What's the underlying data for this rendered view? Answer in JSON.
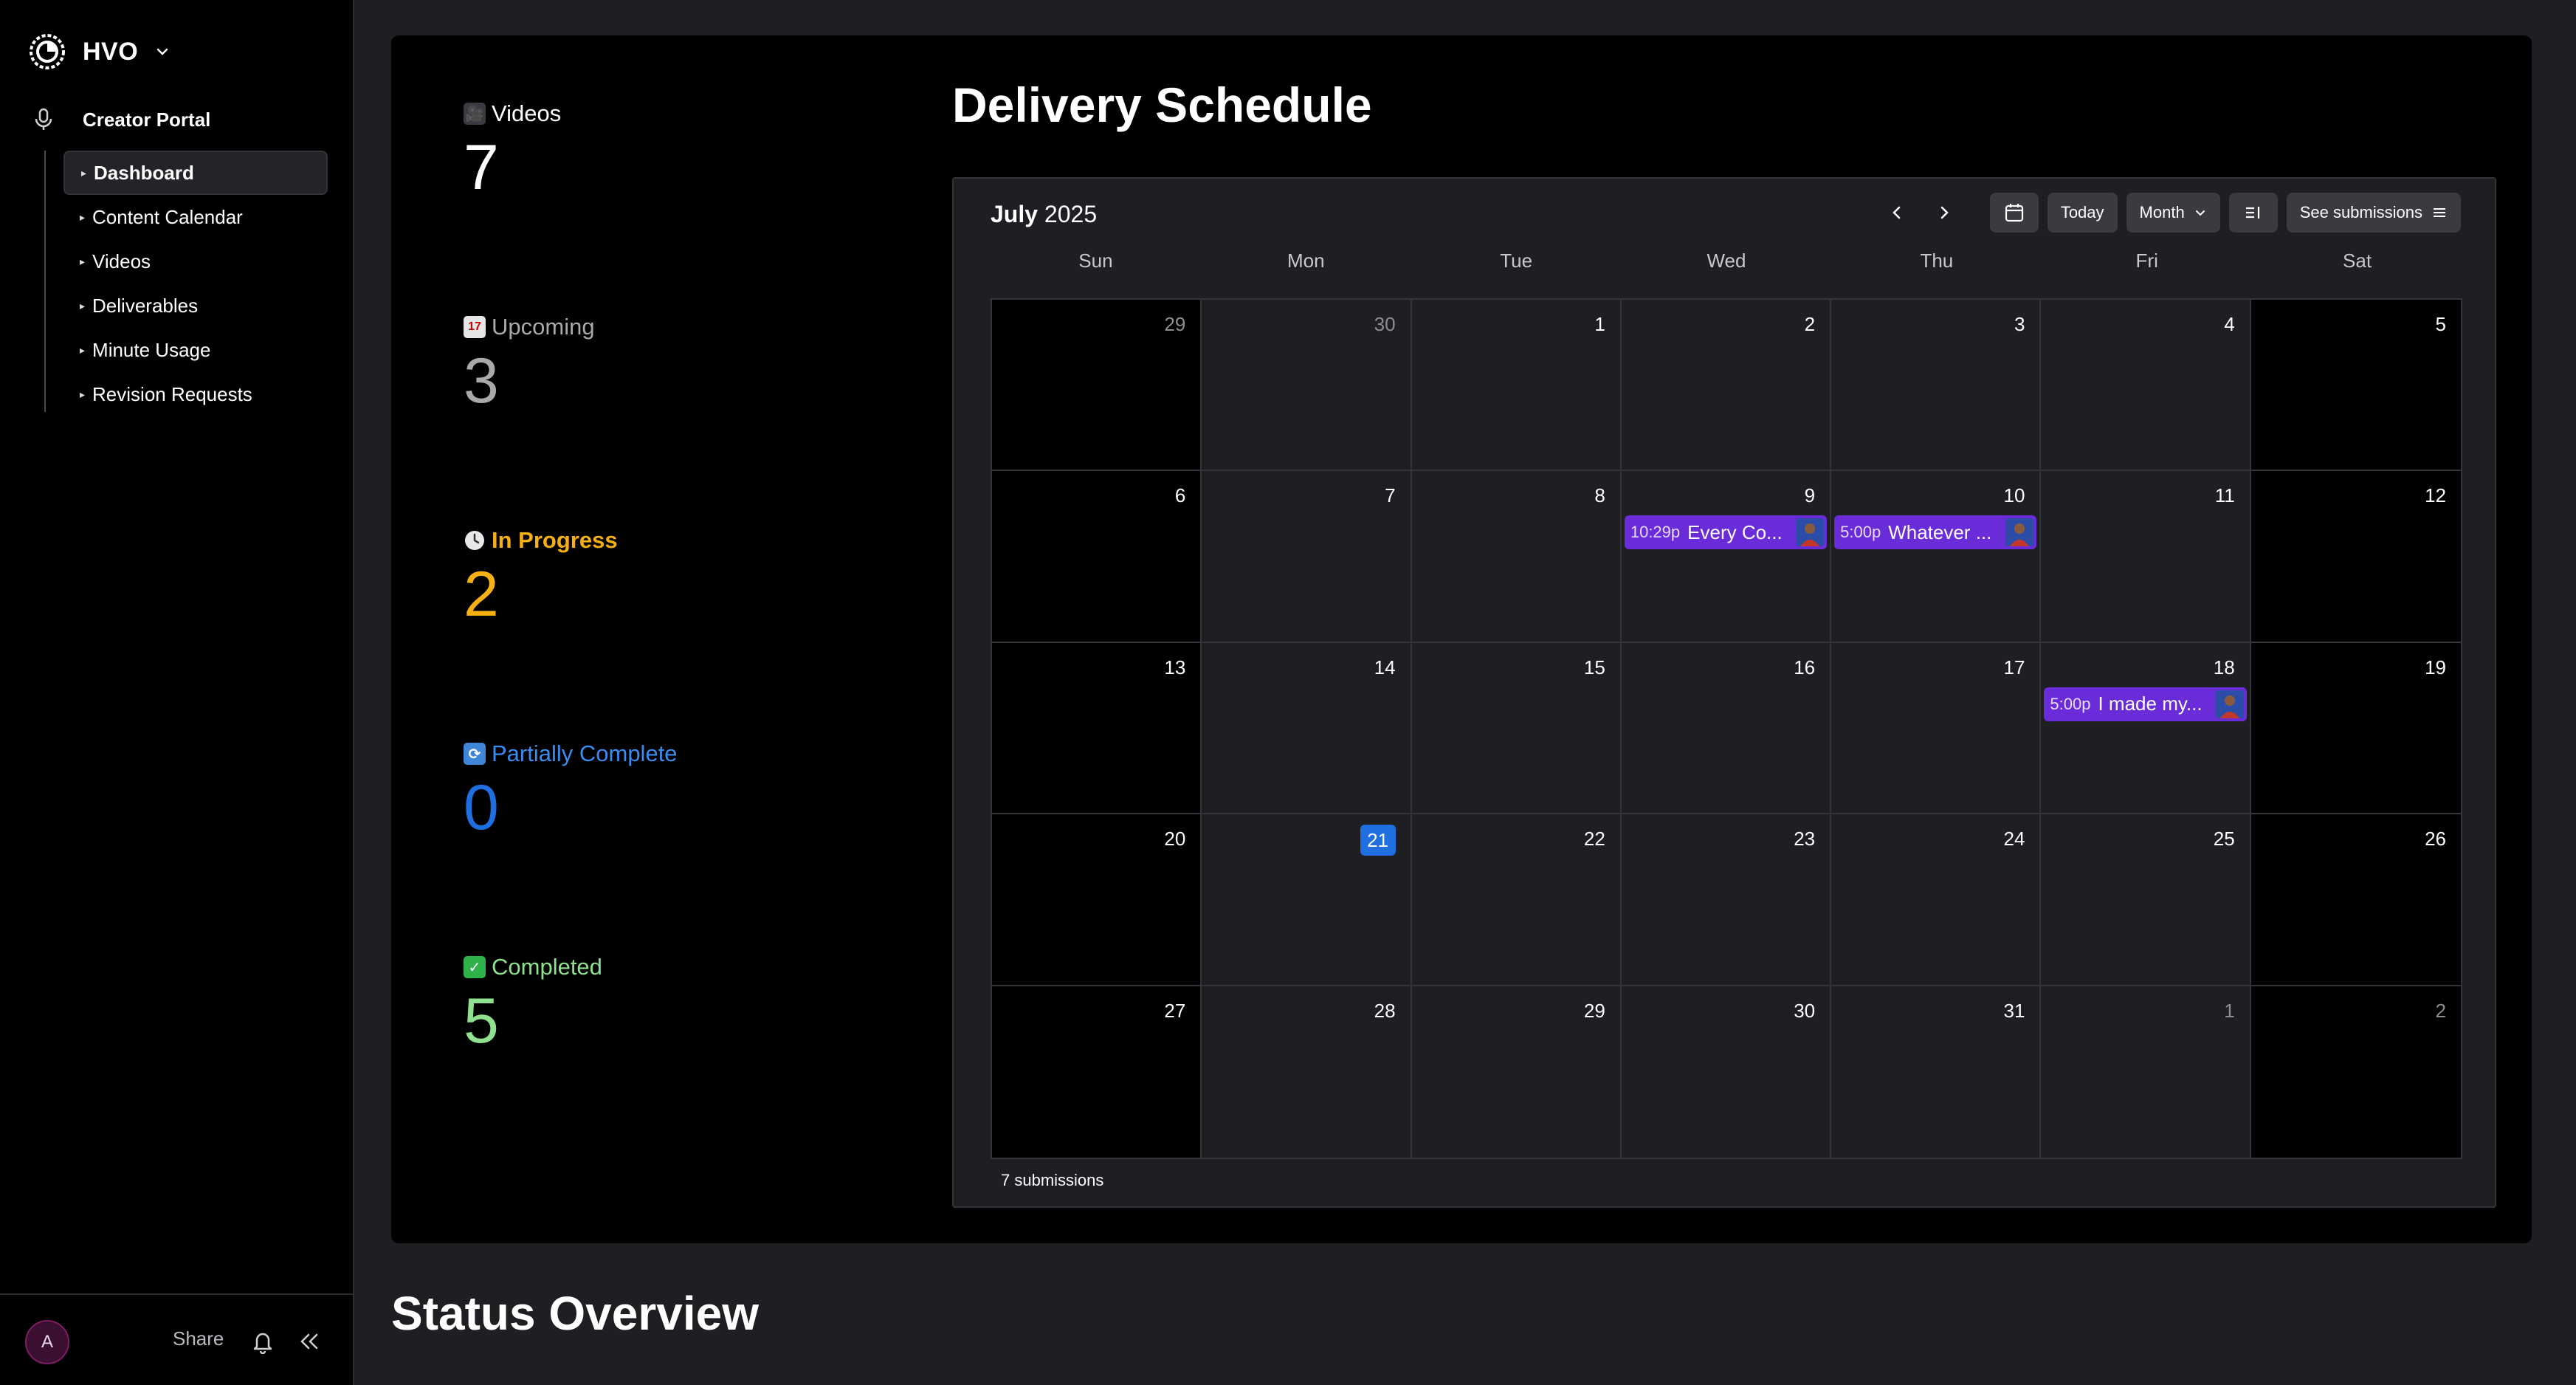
{
  "workspace": {
    "name": "HVO"
  },
  "sidebar": {
    "section_label": "Creator Portal",
    "items": [
      {
        "label": "Dashboard",
        "active": true
      },
      {
        "label": "Content Calendar",
        "active": false
      },
      {
        "label": "Videos",
        "active": false
      },
      {
        "label": "Deliverables",
        "active": false
      },
      {
        "label": "Minute Usage",
        "active": false
      },
      {
        "label": "Revision Requests",
        "active": false
      }
    ],
    "footer": {
      "avatar_initial": "A",
      "share_label": "Share"
    }
  },
  "stats": [
    {
      "icon": "film-camera-icon",
      "label": "Videos",
      "value": "7",
      "color": "#ffffff"
    },
    {
      "icon": "calendar-icon",
      "label": "Upcoming",
      "value": "3",
      "color": "#a9a9a9"
    },
    {
      "icon": "clock-icon",
      "label": "In Progress",
      "value": "2",
      "color": "#f5b014"
    },
    {
      "icon": "repeat-icon",
      "label": "Partially Complete",
      "value": "0",
      "color": "#1f6fe0"
    },
    {
      "icon": "check-icon",
      "label": "Completed",
      "value": "5",
      "color": "#8fe08f"
    }
  ],
  "schedule": {
    "title": "Delivery Schedule",
    "month": "July",
    "year": "2025",
    "today_label": "Today",
    "view_label": "Month",
    "see_submissions_label": "See submissions",
    "weekdays": [
      "Sun",
      "Mon",
      "Tue",
      "Wed",
      "Thu",
      "Fri",
      "Sat"
    ],
    "weeks": [
      [
        {
          "day": "29",
          "muted": true
        },
        {
          "day": "30",
          "muted": true
        },
        {
          "day": "1"
        },
        {
          "day": "2"
        },
        {
          "day": "3"
        },
        {
          "day": "4"
        },
        {
          "day": "5"
        }
      ],
      [
        {
          "day": "6"
        },
        {
          "day": "7"
        },
        {
          "day": "8"
        },
        {
          "day": "9",
          "event": {
            "time": "10:29p",
            "title": "Every Co..."
          }
        },
        {
          "day": "10",
          "event": {
            "time": "5:00p",
            "title": "Whatever ..."
          }
        },
        {
          "day": "11"
        },
        {
          "day": "12"
        }
      ],
      [
        {
          "day": "13"
        },
        {
          "day": "14"
        },
        {
          "day": "15"
        },
        {
          "day": "16"
        },
        {
          "day": "17"
        },
        {
          "day": "18",
          "event": {
            "time": "5:00p",
            "title": "I made my..."
          }
        },
        {
          "day": "19"
        }
      ],
      [
        {
          "day": "20"
        },
        {
          "day": "21",
          "today": true
        },
        {
          "day": "22"
        },
        {
          "day": "23"
        },
        {
          "day": "24"
        },
        {
          "day": "25"
        },
        {
          "day": "26"
        }
      ],
      [
        {
          "day": "27"
        },
        {
          "day": "28"
        },
        {
          "day": "29"
        },
        {
          "day": "30"
        },
        {
          "day": "31"
        },
        {
          "day": "1",
          "muted": true
        },
        {
          "day": "2",
          "muted": true
        }
      ]
    ],
    "footer_text": "7 submissions"
  },
  "status_overview": {
    "title": "Status Overview"
  },
  "colors": {
    "event": "#6a2bd9",
    "today": "#1f6fe0",
    "card": "#000000",
    "page": "#1e1f23"
  }
}
